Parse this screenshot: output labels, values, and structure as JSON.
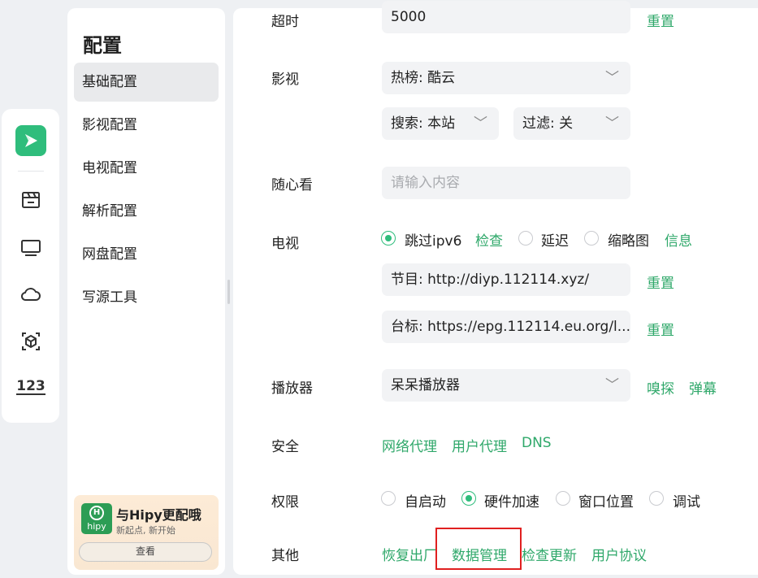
{
  "rail": {
    "icons": [
      "app-logo-icon",
      "movie-icon",
      "tv-icon",
      "cloud-icon",
      "box-icon",
      "numbers-icon"
    ],
    "numbers_text": "123"
  },
  "sidebar": {
    "title": "配置",
    "items": [
      {
        "label": "基础配置",
        "active": true
      },
      {
        "label": "影视配置"
      },
      {
        "label": "电视配置"
      },
      {
        "label": "解析配置"
      },
      {
        "label": "网盘配置"
      },
      {
        "label": "写源工具"
      }
    ],
    "promo": {
      "logo_text": "hipy",
      "title": "与Hipy更配哦",
      "subtitle": "新起点, 新开始",
      "button": "查看"
    }
  },
  "main": {
    "timeout": {
      "label": "超时",
      "value": "5000",
      "reset": "重置"
    },
    "movie": {
      "label": "影视",
      "hot_select": "热榜: 酷云",
      "search_select": "搜索: 本站",
      "filter_select": "过滤: 关"
    },
    "random": {
      "label": "随心看",
      "placeholder": "请输入内容"
    },
    "tv": {
      "label": "电视",
      "options": [
        "跳过ipv6",
        "延迟",
        "缩略图"
      ],
      "check_link": "检查",
      "info_link": "信息",
      "program": "节目: http://diyp.112114.xyz/",
      "logo_url": "台标: https://epg.112114.eu.org/l...",
      "reset1": "重置",
      "reset2": "重置"
    },
    "player": {
      "label": "播放器",
      "value": "呆呆播放器",
      "sniff": "嗅探",
      "danmaku": "弹幕"
    },
    "security": {
      "label": "安全",
      "links": [
        "网络代理",
        "用户代理",
        "DNS"
      ]
    },
    "permission": {
      "label": "权限",
      "options": [
        "自启动",
        "硬件加速",
        "窗口位置",
        "调试"
      ],
      "selected": "硬件加速"
    },
    "other": {
      "label": "其他",
      "links": [
        "恢复出厂",
        "数据管理",
        "检查更新",
        "用户协议"
      ]
    }
  },
  "colors": {
    "accent": "#2fbd7c",
    "link": "#2fa86a",
    "highlight": "#e02020"
  }
}
